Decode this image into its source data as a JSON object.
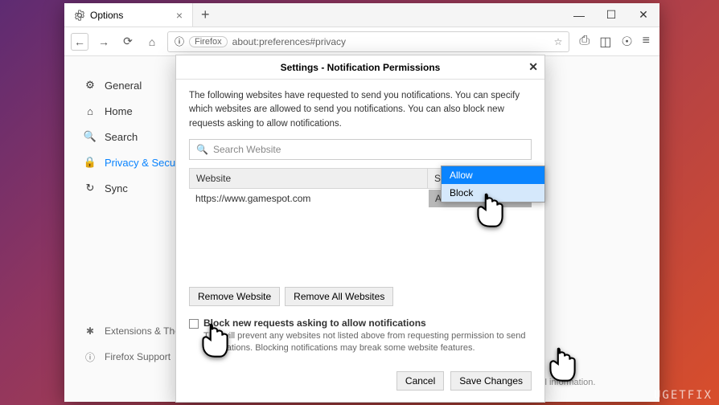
{
  "window": {
    "tab_title": "Options",
    "url_badge": "Firefox",
    "url": "about:preferences#privacy"
  },
  "sidebar": {
    "items": [
      {
        "label": "General",
        "icon": "gear"
      },
      {
        "label": "Home",
        "icon": "home"
      },
      {
        "label": "Search",
        "icon": "search"
      },
      {
        "label": "Privacy & Security",
        "icon": "lock",
        "active": true
      },
      {
        "label": "Sync",
        "icon": "sync"
      }
    ],
    "bottom_items": [
      {
        "label": "Extensions & Themes",
        "icon": "puzzle"
      },
      {
        "label": "Firefox Support",
        "icon": "help"
      }
    ]
  },
  "dialog": {
    "title": "Settings - Notification Permissions",
    "intro": "The following websites have requested to send you notifications. You can specify which websites are allowed to send you notifications. You can also block new requests asking to allow notifications.",
    "search_placeholder": "Search Website",
    "table": {
      "header_website": "Website",
      "header_status": "Status",
      "rows": [
        {
          "website": "https://www.gamespot.com",
          "status": "Allow"
        }
      ]
    },
    "dropdown_options": [
      {
        "label": "Allow",
        "selected": true
      },
      {
        "label": "Block",
        "selected": false
      }
    ],
    "remove_button": "Remove Website",
    "remove_all_button": "Remove All Websites",
    "checkbox_label": "Block new requests asking to allow notifications",
    "checkbox_desc": "This will prevent any websites not listed above from requesting permission to send notifications. Blocking notifications may break some website features.",
    "cancel_button": "Cancel",
    "save_button": "Save Changes"
  },
  "footer_text": "Firefox for everyone. We always ask permission before receiving personal information.",
  "watermark": "UGETFIX"
}
